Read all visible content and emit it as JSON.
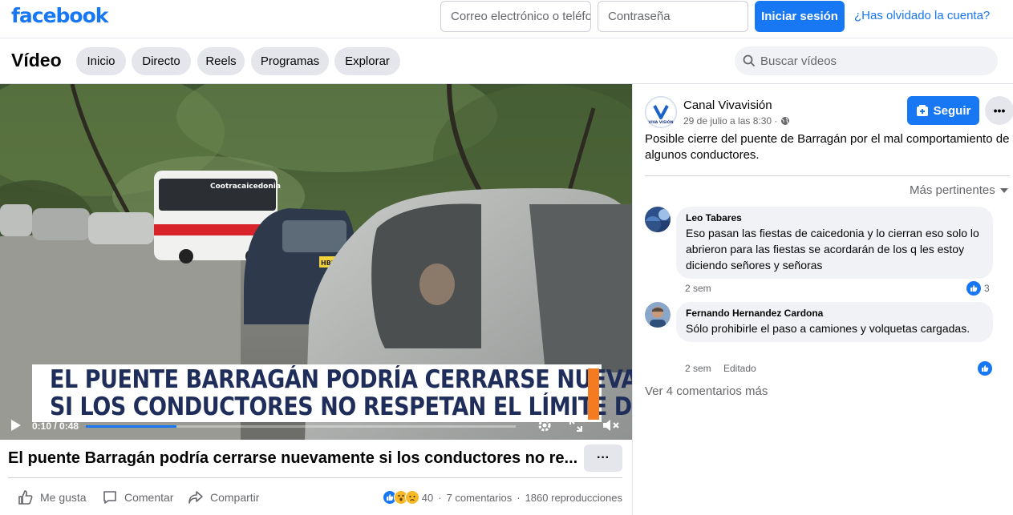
{
  "header": {
    "logo": "facebook",
    "email_placeholder": "Correo electrónico o teléfono",
    "password_placeholder": "Contraseña",
    "login_label": "Iniciar sesión",
    "forgot_label": "¿Has olvidado la cuenta?"
  },
  "video_nav": {
    "title": "Vídeo",
    "tabs": [
      {
        "label": "Inicio"
      },
      {
        "label": "Directo"
      },
      {
        "label": "Reels"
      },
      {
        "label": "Programas"
      },
      {
        "label": "Explorar"
      }
    ],
    "search_placeholder": "Buscar vídeos"
  },
  "player": {
    "caption_line1": "EL PUENTE BARRAGÁN PODRÍA CERRARSE NUEVAMENTE",
    "caption_line2": "SI LOS CONDUCTORES NO RESPETAN EL LÍMITE DE PESO.",
    "bus_text": "Cootracaicedonia",
    "plate_text": "HBK 88",
    "time": "0:10 / 0:48",
    "progress_fraction": 0.21
  },
  "video_info": {
    "title": "El puente Barragán podría cerrarse nuevamente si los conductores no re...",
    "more_label": "···",
    "like_label": "Me gusta",
    "comment_label": "Comentar",
    "share_label": "Compartir",
    "reaction_count": "40",
    "comments_count": "7 comentarios",
    "views_count": "1860 reproducciones",
    "separator": "·"
  },
  "post": {
    "channel_name": "Canal Vivavisión",
    "channel_avatar_text": "VIVA VISIÓN",
    "date": "29 de julio a las 8:30 ·",
    "follow_label": "Seguir",
    "more_label": "•••",
    "text": "Posible cierre del puente de Barragán por el mal comportamiento de algunos conductores.",
    "sort_label": "Más pertinentes"
  },
  "comments": [
    {
      "author": "Leo Tabares",
      "text": "Eso pasan las fiestas de caicedonia y lo cierran eso solo lo abrieron para las fiestas se acordarán de los q les estoy diciendo señores y señoras",
      "time": "2 sem",
      "edited": "",
      "likes": "3"
    },
    {
      "author": "Fernando Hernandez Cardona",
      "text": "Sólo prohibirle el paso a camiones y volquetas cargadas.",
      "time": "2 sem",
      "edited": "Editado",
      "likes": ""
    }
  ],
  "more_comments_label": "Ver 4 comentarios más",
  "colors": {
    "brand": "#1877f2",
    "caption_text": "#1f2d5a",
    "caption_stripe": "#f47b20"
  },
  "icons": [
    "search-icon",
    "play-icon",
    "settings-icon",
    "fullscreen-icon",
    "mute-icon",
    "like-icon",
    "comment-icon",
    "share-icon",
    "globe-icon",
    "follow-icon",
    "sort-down-icon"
  ]
}
